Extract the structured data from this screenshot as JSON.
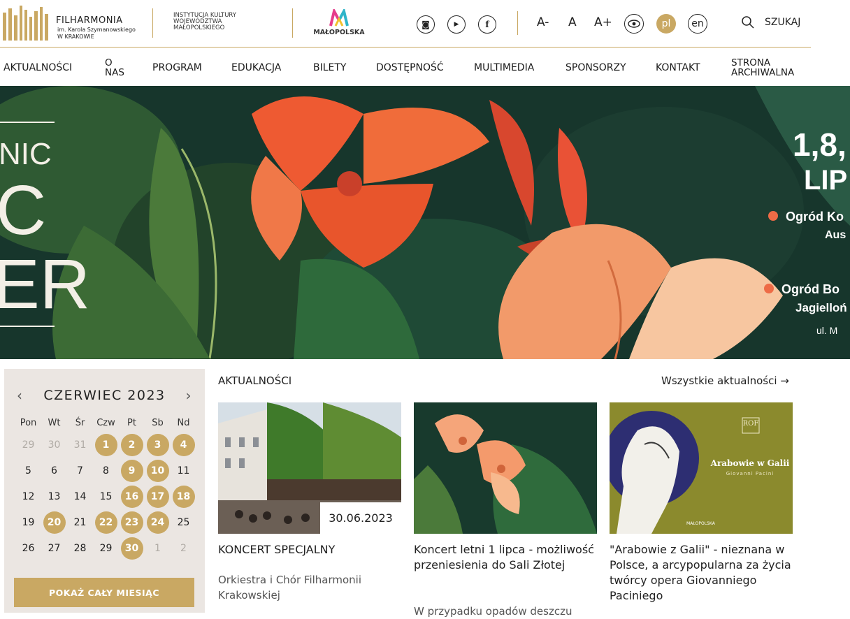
{
  "header": {
    "logo": {
      "name": "FILHARMONIA",
      "sub1": "im. Karola Szymanowskiego",
      "sub2": "W KRAKOWIE"
    },
    "institution": [
      "INSTYTUCJA KULTURY",
      "WOJEWÓDZTWA",
      "MAŁOPOLSKIEGO"
    ],
    "region_logo": "MAŁOPOLSKA",
    "social": [
      {
        "name": "instagram-icon",
        "glyph": "◙"
      },
      {
        "name": "youtube-icon",
        "glyph": "▶"
      },
      {
        "name": "facebook-icon",
        "glyph": "f"
      }
    ],
    "font_controls": {
      "smaller": "A-",
      "normal": "A",
      "larger": "A+"
    },
    "langs": {
      "pl": "pl",
      "en": "en"
    },
    "search_label": "SZUKAJ"
  },
  "nav": [
    {
      "label": "AKTUALNOŚCI"
    },
    {
      "label": "O NAS"
    },
    {
      "label": "PROGRAM"
    },
    {
      "label": "EDUKACJA"
    },
    {
      "label": "BILETY"
    },
    {
      "label": "DOSTĘPNOŚĆ"
    },
    {
      "label": "MULTIMEDIA"
    },
    {
      "label": "SPONSORZY"
    },
    {
      "label": "KONTAKT"
    },
    {
      "label": "STRONA ARCHIWALNA"
    }
  ],
  "hero": {
    "left_lines": [
      "NIC",
      "C",
      "ER"
    ],
    "right_title_1": "1,8,",
    "right_title_2": "LIP",
    "loc1_a": "Ogród Ko",
    "loc1_b": "Aus",
    "loc2_a": "Ogród Bo",
    "loc2_b": "Jagielloń",
    "loc2_c": "ul. M"
  },
  "calendar": {
    "month": "CZERWIEC 2023",
    "prev": "‹",
    "next": "›",
    "dow": [
      "Pon",
      "Wt",
      "Śr",
      "Czw",
      "Pt",
      "Sb",
      "Nd"
    ],
    "weeks": [
      [
        {
          "d": "29",
          "s": "muted"
        },
        {
          "d": "30",
          "s": "muted"
        },
        {
          "d": "31",
          "s": "muted"
        },
        {
          "d": "1",
          "s": "on"
        },
        {
          "d": "2",
          "s": "on"
        },
        {
          "d": "3",
          "s": "on"
        },
        {
          "d": "4",
          "s": "on"
        }
      ],
      [
        {
          "d": "5",
          "s": ""
        },
        {
          "d": "6",
          "s": ""
        },
        {
          "d": "7",
          "s": ""
        },
        {
          "d": "8",
          "s": ""
        },
        {
          "d": "9",
          "s": "on"
        },
        {
          "d": "10",
          "s": "on"
        },
        {
          "d": "11",
          "s": ""
        }
      ],
      [
        {
          "d": "12",
          "s": ""
        },
        {
          "d": "13",
          "s": ""
        },
        {
          "d": "14",
          "s": ""
        },
        {
          "d": "15",
          "s": ""
        },
        {
          "d": "16",
          "s": "on"
        },
        {
          "d": "17",
          "s": "on"
        },
        {
          "d": "18",
          "s": "on"
        }
      ],
      [
        {
          "d": "19",
          "s": ""
        },
        {
          "d": "20",
          "s": "on"
        },
        {
          "d": "21",
          "s": ""
        },
        {
          "d": "22",
          "s": "on"
        },
        {
          "d": "23",
          "s": "on"
        },
        {
          "d": "24",
          "s": "on"
        },
        {
          "d": "25",
          "s": ""
        }
      ],
      [
        {
          "d": "26",
          "s": ""
        },
        {
          "d": "27",
          "s": ""
        },
        {
          "d": "28",
          "s": ""
        },
        {
          "d": "29",
          "s": ""
        },
        {
          "d": "30",
          "s": "on"
        },
        {
          "d": "1",
          "s": "muted"
        },
        {
          "d": "2",
          "s": "muted"
        }
      ]
    ],
    "button": "POKAŻ CAŁY MIESIĄC"
  },
  "news": {
    "title": "AKTUALNOŚCI",
    "all_link": "Wszystkie aktualności →",
    "cards": [
      {
        "date": "30.06.2023",
        "title": "KONCERT SPECJALNY",
        "desc": "Orkiestra i Chór Filharmonii Krakowskiej"
      },
      {
        "title": "Koncert letni 1 lipca - możliwość przeniesienia do Sali Złotej",
        "desc": "W przypadku opadów deszczu"
      },
      {
        "title": "\"Arabowie z Galii\" - nieznana w Polsce, a arcypopularna za życia twórcy opera Giovanniego Paciniego",
        "poster": {
          "logo": "ROF",
          "title": "Arabowie w Galii",
          "composer": "Giovanni Pacini",
          "region": "MAŁOPOLSKA"
        }
      }
    ]
  },
  "colors": {
    "accent": "#c9a863",
    "calendar_bg": "#ebe6e2",
    "hero_bg": "#17362c"
  }
}
